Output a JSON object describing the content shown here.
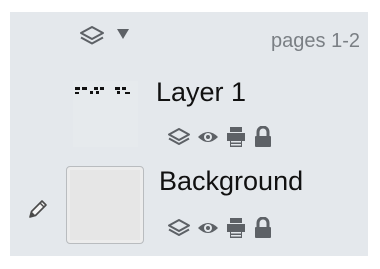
{
  "header": {
    "layers_icon": "layers-icon",
    "dropdown_icon": "triangle-down-icon",
    "pages_label": "pages 1-2"
  },
  "layers": [
    {
      "name": "Layer 1",
      "thumbnail": "layer-thumbnail-dashes",
      "icons": [
        "layers-icon",
        "eye-icon",
        "printer-icon",
        "lock-icon"
      ]
    },
    {
      "name": "Background",
      "thumbnail": "layer-thumbnail-blank",
      "edit_icon": "pencil-icon",
      "icons": [
        "layers-icon",
        "eye-icon",
        "printer-icon",
        "lock-icon"
      ]
    }
  ],
  "colors": {
    "panel_background": "#e4e8ec",
    "icon_gray": "#5d6166",
    "text": "#111111",
    "pages_label": "#7a7f84"
  }
}
